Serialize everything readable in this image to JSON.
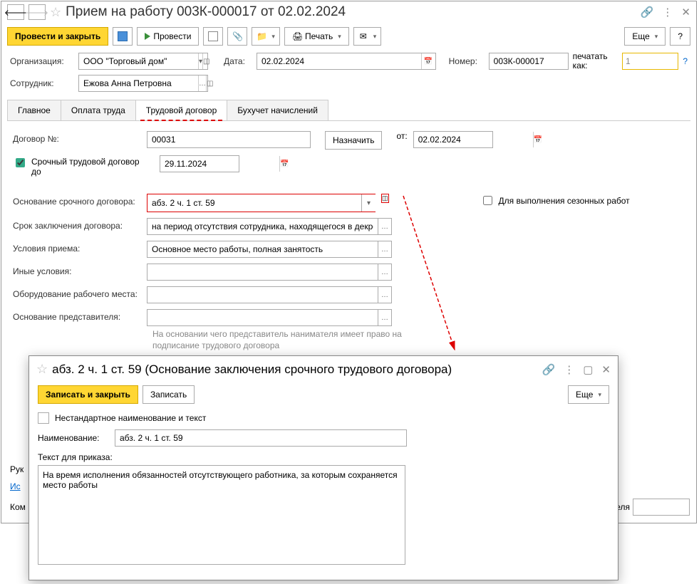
{
  "header": {
    "title": "Прием на работу 003К-000017 от 02.02.2024"
  },
  "toolbar": {
    "post_close": "Провести и закрыть",
    "post": "Провести",
    "print": "Печать",
    "more": "Еще",
    "help": "?"
  },
  "form": {
    "org_label": "Организация:",
    "org_value": "ООО \"Торговый дом\"",
    "date_label": "Дата:",
    "date_value": "02.02.2024",
    "number_label": "Номер:",
    "number_value": "003К-000017",
    "print_as_label": "печатать как:",
    "print_as_value": "1",
    "employee_label": "Сотрудник:",
    "employee_value": "Ежова Анна Петровна"
  },
  "tabs": {
    "main": "Главное",
    "pay": "Оплата труда",
    "contract": "Трудовой договор",
    "accounting": "Бухучет начислений"
  },
  "contract": {
    "contract_no_label": "Договор №:",
    "contract_no_value": "00031",
    "assign_btn": "Назначить",
    "from_label": "от:",
    "from_value": "02.02.2024",
    "fixed_term_label": "Срочный трудовой договор до",
    "fixed_term_date": "29.11.2024",
    "basis_label": "Основание срочного договора:",
    "basis_value": "абз. 2 ч. 1 ст. 59",
    "seasonal_label": "Для выполнения сезонных работ",
    "duration_label": "Срок заключения договора:",
    "duration_value": "на период отсутствия сотрудника, находящегося в декрете",
    "conditions_label": "Условия приема:",
    "conditions_value": "Основное место работы, полная занятость",
    "other_label": "Иные условия:",
    "other_value": "",
    "equipment_label": "Оборудование рабочего места:",
    "equipment_value": "",
    "rep_basis_label": "Основание представителя:",
    "rep_basis_value": "",
    "rep_hint": "На основании чего представитель нанимателя имеет право на подписание трудового договора"
  },
  "footer": {
    "manager_label": "Рук",
    "link_his": "Ис",
    "comment_label": "Ком",
    "tail": "ателя"
  },
  "popup": {
    "title": "абз. 2 ч. 1 ст. 59 (Основание заключения срочного трудового договора)",
    "save_close": "Записать и закрыть",
    "save": "Записать",
    "more": "Еще",
    "nonstd_label": "Нестандартное наименование и текст",
    "name_label": "Наименование:",
    "name_value": "абз. 2 ч. 1 ст. 59",
    "text_label": "Текст для приказа:",
    "text_value": "На время исполнения обязанностей отсутствующего работника, за которым сохраняется место работы"
  }
}
